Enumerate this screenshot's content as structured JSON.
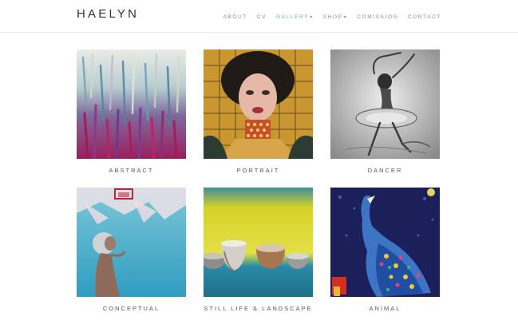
{
  "site": {
    "logo": "HAELYN"
  },
  "nav": [
    {
      "label": "ABOUT"
    },
    {
      "label": "CV"
    },
    {
      "label": "GALLERY",
      "active": true,
      "has_dropdown": true
    },
    {
      "label": "SHOP",
      "has_dropdown": true
    },
    {
      "label": "COMISSION"
    },
    {
      "label": "CONTACT"
    }
  ],
  "gallery": [
    {
      "label": "ABSTRACT"
    },
    {
      "label": "PORTRAIT"
    },
    {
      "label": "DANCER"
    },
    {
      "label": "CONCEPTUAL"
    },
    {
      "label": "STILL LIFE & LANDSCAPE"
    },
    {
      "label": "ANIMAL"
    }
  ],
  "colors": {
    "accent": "#5fb89a",
    "nav_text": "#8a8f94",
    "caption_text": "#555555"
  }
}
